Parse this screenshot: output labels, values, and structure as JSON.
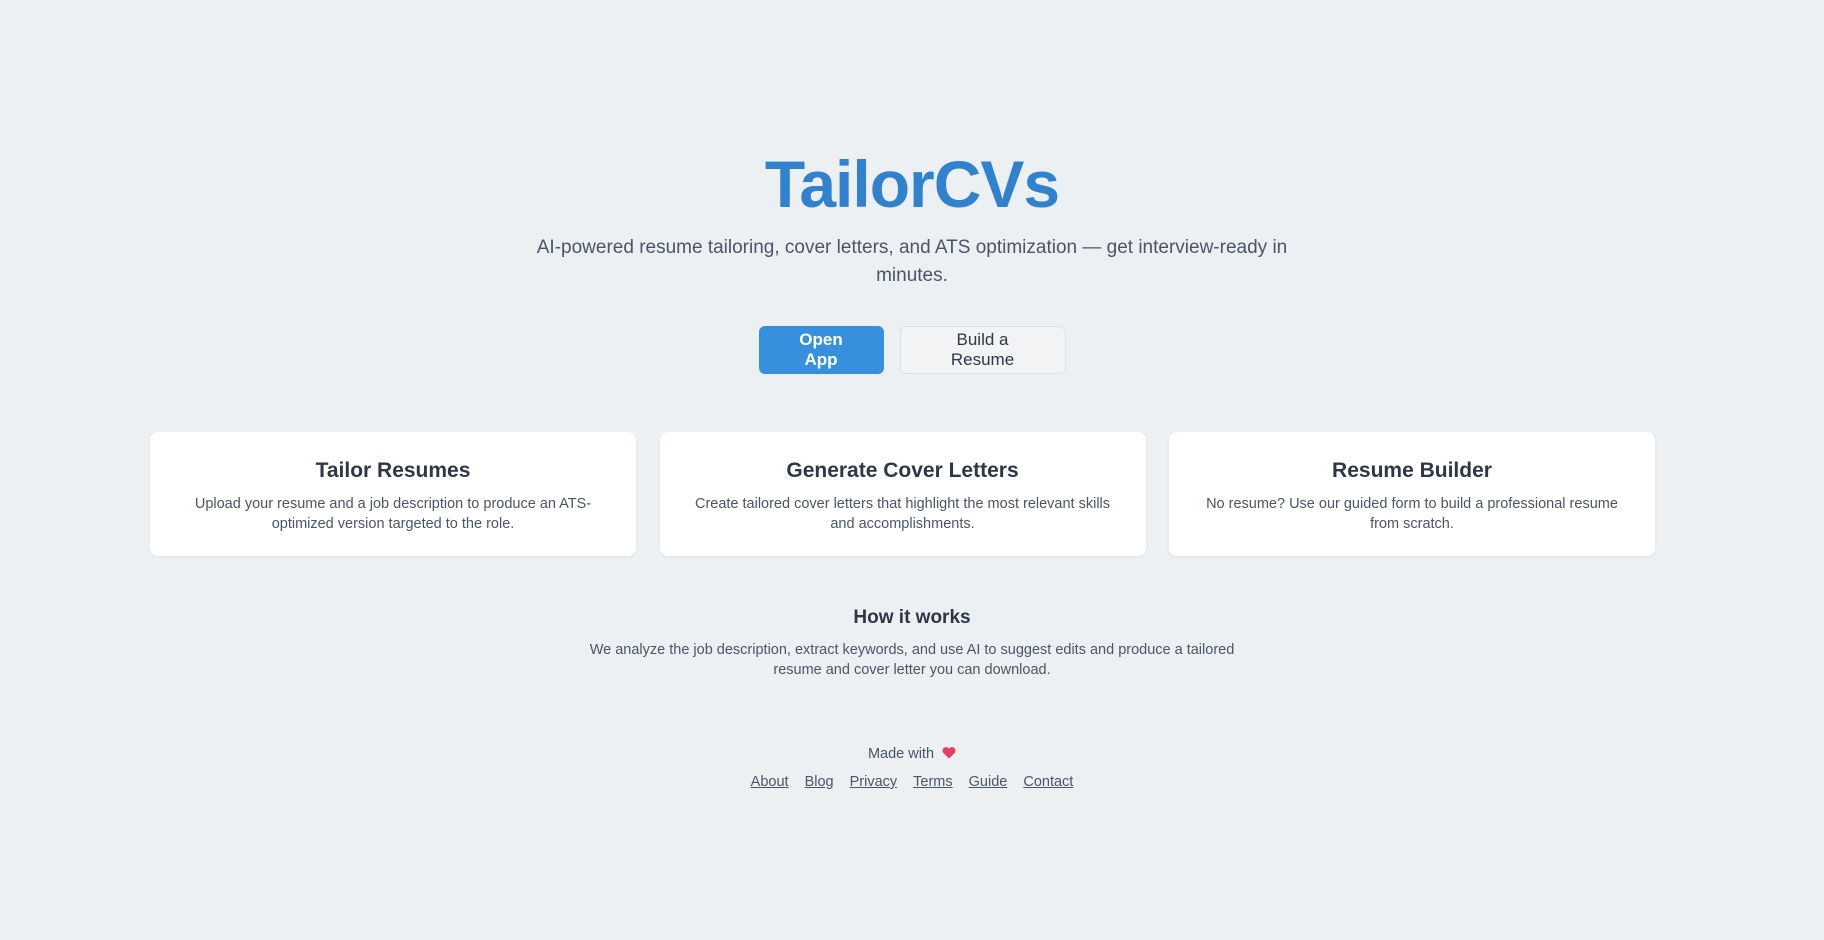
{
  "hero": {
    "title": "TailorCVs",
    "subtitle": "AI-powered resume tailoring, cover letters, and ATS optimization — get interview-ready in minutes.",
    "primary_button": "Open App",
    "secondary_button": "Build a Resume"
  },
  "features": [
    {
      "title": "Tailor Resumes",
      "description": "Upload your resume and a job description to produce an ATS-optimized version targeted to the role."
    },
    {
      "title": "Generate Cover Letters",
      "description": "Create tailored cover letters that highlight the most relevant skills and accomplishments."
    },
    {
      "title": "Resume Builder",
      "description": "No resume? Use our guided form to build a professional resume from scratch."
    }
  ],
  "how_it_works": {
    "title": "How it works",
    "description": "We analyze the job description, extract keywords, and use AI to suggest edits and produce a tailored resume and cover letter you can download."
  },
  "footer": {
    "made_with": "Made with",
    "heart_icon": "heart-icon",
    "links": [
      "About",
      "Blog",
      "Privacy",
      "Terms",
      "Guide",
      "Contact"
    ]
  },
  "colors": {
    "accent": "#3182ce",
    "primary_button": "#3690dd",
    "background": "#edf0f3",
    "heart": "#e53e5f"
  }
}
